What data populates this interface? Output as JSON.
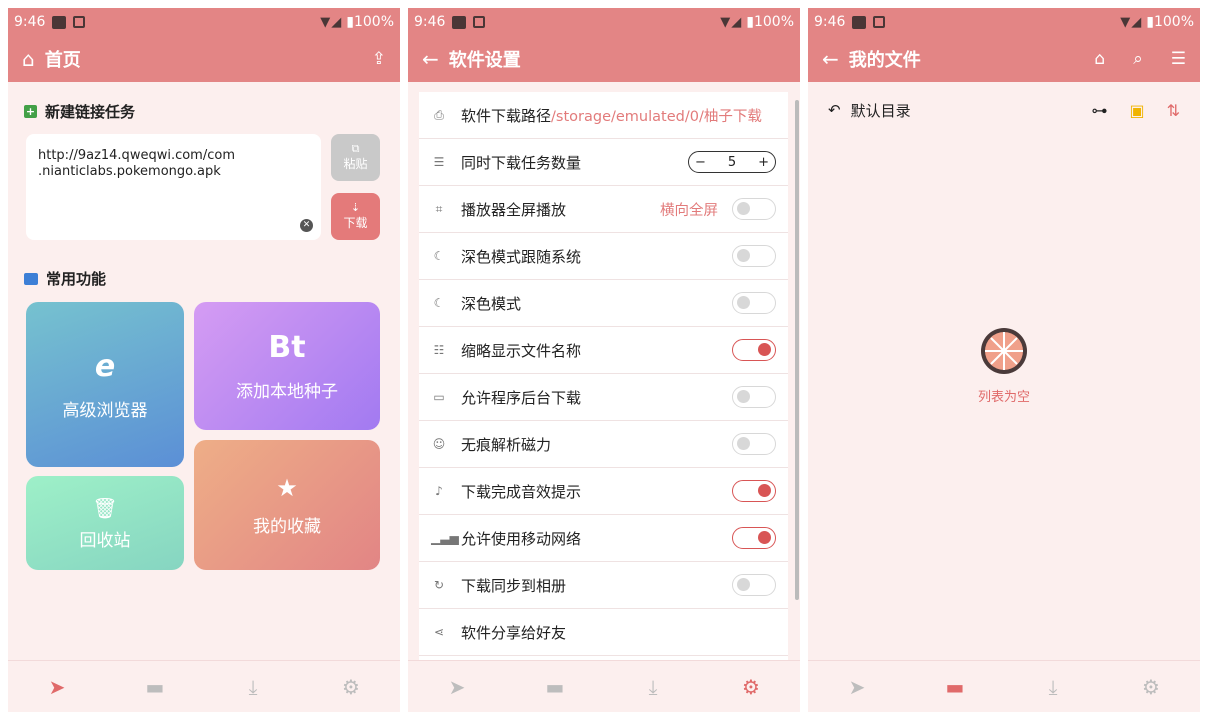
{
  "status": {
    "time": "9:46",
    "battery": "100%"
  },
  "home": {
    "title": "首页",
    "new_task_label": "新建链接任务",
    "link_line1": "http://9az14.qweqwi.com/com",
    "link_line2": ".nianticlabs.pokemongo.apk",
    "paste_label": "粘贴",
    "download_label": "下载",
    "common_label": "常用功能",
    "tiles": {
      "browser": {
        "label": "高级浏览器",
        "glyph": "e"
      },
      "seed": {
        "label": "添加本地种子",
        "glyph": "Bt"
      },
      "recycle": {
        "label": "回收站"
      },
      "favorites": {
        "label": "我的收藏"
      }
    }
  },
  "settings": {
    "title": "软件设置",
    "rows": [
      {
        "label": "软件下载路径",
        "path": "/storage/emulated/0/柚子下载"
      },
      {
        "label": "同时下载任务数量",
        "stepper_value": "5"
      },
      {
        "label": "播放器全屏播放",
        "value": "横向全屏",
        "toggle": false
      },
      {
        "label": "深色模式跟随系统",
        "toggle": false
      },
      {
        "label": "深色模式",
        "toggle": false
      },
      {
        "label": "缩略显示文件名称",
        "toggle": true
      },
      {
        "label": "允许程序后台下载",
        "toggle": false
      },
      {
        "label": "无痕解析磁力",
        "toggle": false
      },
      {
        "label": "下载完成音效提示",
        "toggle": true
      },
      {
        "label": "允许使用移动网络",
        "toggle": true
      },
      {
        "label": "下载同步到相册",
        "toggle": false
      },
      {
        "label": "软件分享给好友"
      }
    ]
  },
  "files": {
    "title": "我的文件",
    "dir_label": "默认目录",
    "empty_label": "列表为空"
  },
  "colors": {
    "accent": "#e38585",
    "bg": "#fcefee",
    "toggle_on": "#d85555"
  }
}
